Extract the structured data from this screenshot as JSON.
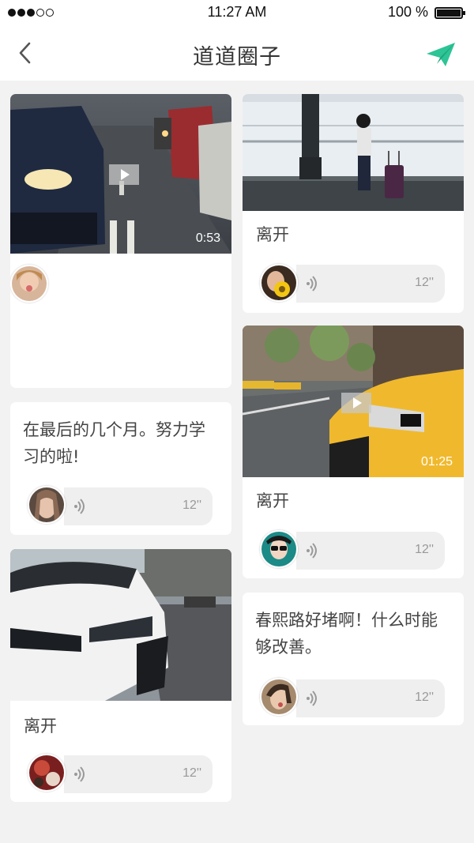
{
  "status_bar": {
    "time": "11:27 AM",
    "battery": "100 %"
  },
  "nav": {
    "title": "道道圈子"
  },
  "cards": {
    "video_street": {
      "duration": "0:53"
    },
    "text_post_1": {
      "text": "在最后的几个月。努力学习的啦!",
      "voice_length": "12''"
    },
    "bmw": {
      "caption": "离开",
      "voice_length": "12''"
    },
    "airport": {
      "caption": "离开",
      "voice_length": "12''"
    },
    "taxi": {
      "duration": "01:25",
      "caption": "离开",
      "voice_length": "12''"
    },
    "text_post_2": {
      "text": "春熙路好堵啊！什么时能够改善。",
      "voice_length": "12''"
    }
  },
  "colors": {
    "accent": "#2dc496",
    "background": "#f2f2f2",
    "voice_bubble": "#efefef"
  }
}
